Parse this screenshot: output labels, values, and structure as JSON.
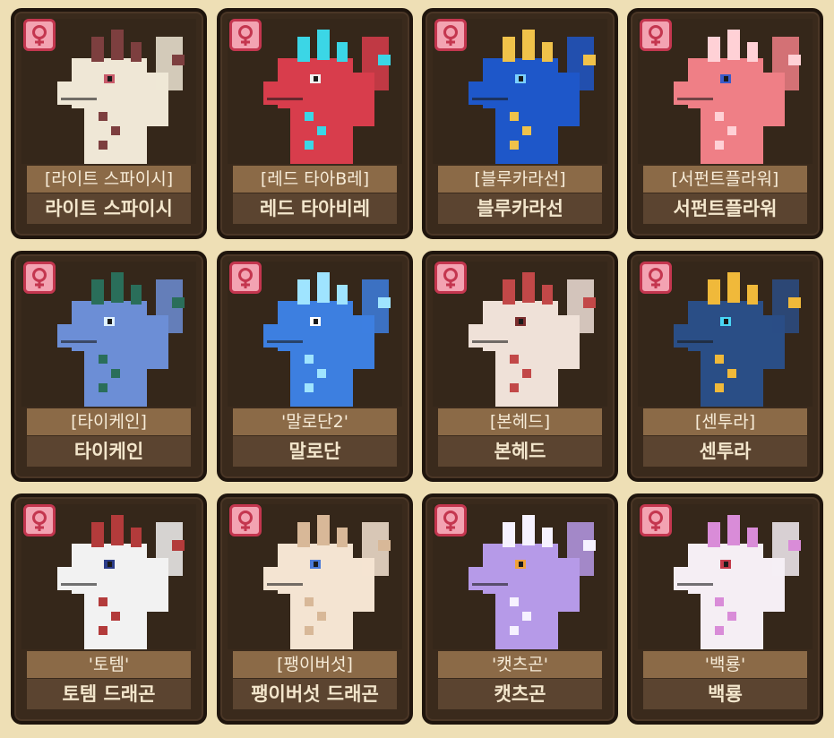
{
  "cards": [
    {
      "tag": "[라이트 스파이시]",
      "name": "라이트 스파이시",
      "icon": "female-icon",
      "body": "#efe7d6",
      "accent": "#7d3f3f",
      "eye": "#c85a6a"
    },
    {
      "tag": "[레드 타아B레]",
      "name": "레드 타아비레",
      "icon": "female-icon",
      "body": "#d83d4c",
      "accent": "#3bd6e6",
      "eye": "#f0f0f0"
    },
    {
      "tag": "[블루카라선]",
      "name": "블루카라선",
      "icon": "female-icon",
      "body": "#1e57c9",
      "accent": "#f0c24a",
      "eye": "#7ad0ff"
    },
    {
      "tag": "[서펀트플라워]",
      "name": "서펀트플라워",
      "icon": "female-icon",
      "body": "#ef7f86",
      "accent": "#ffd1d6",
      "eye": "#3a5bc9"
    },
    {
      "tag": "[타이케인]",
      "name": "타이케인",
      "icon": "female-icon",
      "body": "#6c8ed6",
      "accent": "#2a6e5a",
      "eye": "#e0f2ff"
    },
    {
      "tag": "'말로단2'",
      "name": "말로단",
      "icon": "female-icon",
      "body": "#3d7fe0",
      "accent": "#9fe4ff",
      "eye": "#ffffff"
    },
    {
      "tag": "[본헤드]",
      "name": "본헤드",
      "icon": "female-icon",
      "body": "#efe1d8",
      "accent": "#c24848",
      "eye": "#7a2d2d"
    },
    {
      "tag": "[센투라]",
      "name": "센투라",
      "icon": "female-icon",
      "body": "#2a4e86",
      "accent": "#f0b93a",
      "eye": "#49d6f5"
    },
    {
      "tag": "'토템'",
      "name": "토템 드래곤",
      "icon": "female-icon",
      "body": "#f2f2f2",
      "accent": "#b33b3b",
      "eye": "#2c3d8a"
    },
    {
      "tag": "[팽이버섯]",
      "name": "팽이버섯 드래곤",
      "icon": "female-icon",
      "body": "#f4e4d2",
      "accent": "#d8b898",
      "eye": "#4b7ad8"
    },
    {
      "tag": "'캣츠곤'",
      "name": "캣츠곤",
      "icon": "female-icon",
      "body": "#b69ae8",
      "accent": "#f6f2ff",
      "eye": "#f0a23a"
    },
    {
      "tag": "'백룡'",
      "name": "백룡",
      "icon": "female-icon",
      "body": "#f5eef4",
      "accent": "#d98cd8",
      "eye": "#c33a4a"
    }
  ]
}
